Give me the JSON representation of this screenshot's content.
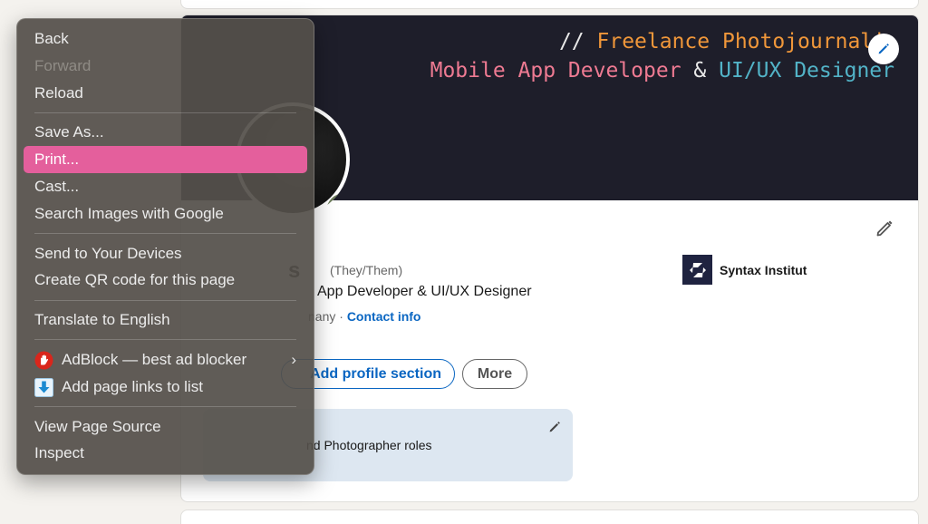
{
  "profile": {
    "banner": {
      "line1_prefix": "//",
      "line1_text": "Freelance Photojournali",
      "line2_part1": "Mobile App Developer",
      "line2_amp": "&",
      "line2_part2": "UI/UX Designer"
    },
    "name_fragment": "s",
    "pronouns": "(They/Them)",
    "headline": "App Developer & UI/UX Designer",
    "location_fragment": "nany ·",
    "contact_link": "Contact info",
    "company": "Syntax Institut",
    "buttons": {
      "add_section": "Add profile section",
      "more": "More"
    },
    "open_to_text": "nd Photographer roles"
  },
  "context_menu": {
    "items": [
      {
        "label": "Back"
      },
      {
        "label": "Forward",
        "disabled": true
      },
      {
        "label": "Reload"
      },
      {
        "label": "Save As..."
      },
      {
        "label": "Print...",
        "highlighted": true
      },
      {
        "label": "Cast..."
      },
      {
        "label": "Search Images with Google"
      },
      {
        "label": "Send to Your Devices"
      },
      {
        "label": "Create QR code for this page"
      },
      {
        "label": "Translate to English"
      },
      {
        "label": "AdBlock — best ad blocker",
        "icon": "adblock-hand-icon",
        "submenu": true
      },
      {
        "label": "Add page links to list",
        "icon": "download-arrow-icon"
      },
      {
        "label": "View Page Source"
      },
      {
        "label": "Inspect"
      }
    ]
  },
  "colors": {
    "menu_highlight": "#e45f9c",
    "banner_orange": "#f0973a",
    "banner_pink": "#ee7a92",
    "banner_teal": "#52b3c7",
    "link_blue": "#0a66c2"
  }
}
